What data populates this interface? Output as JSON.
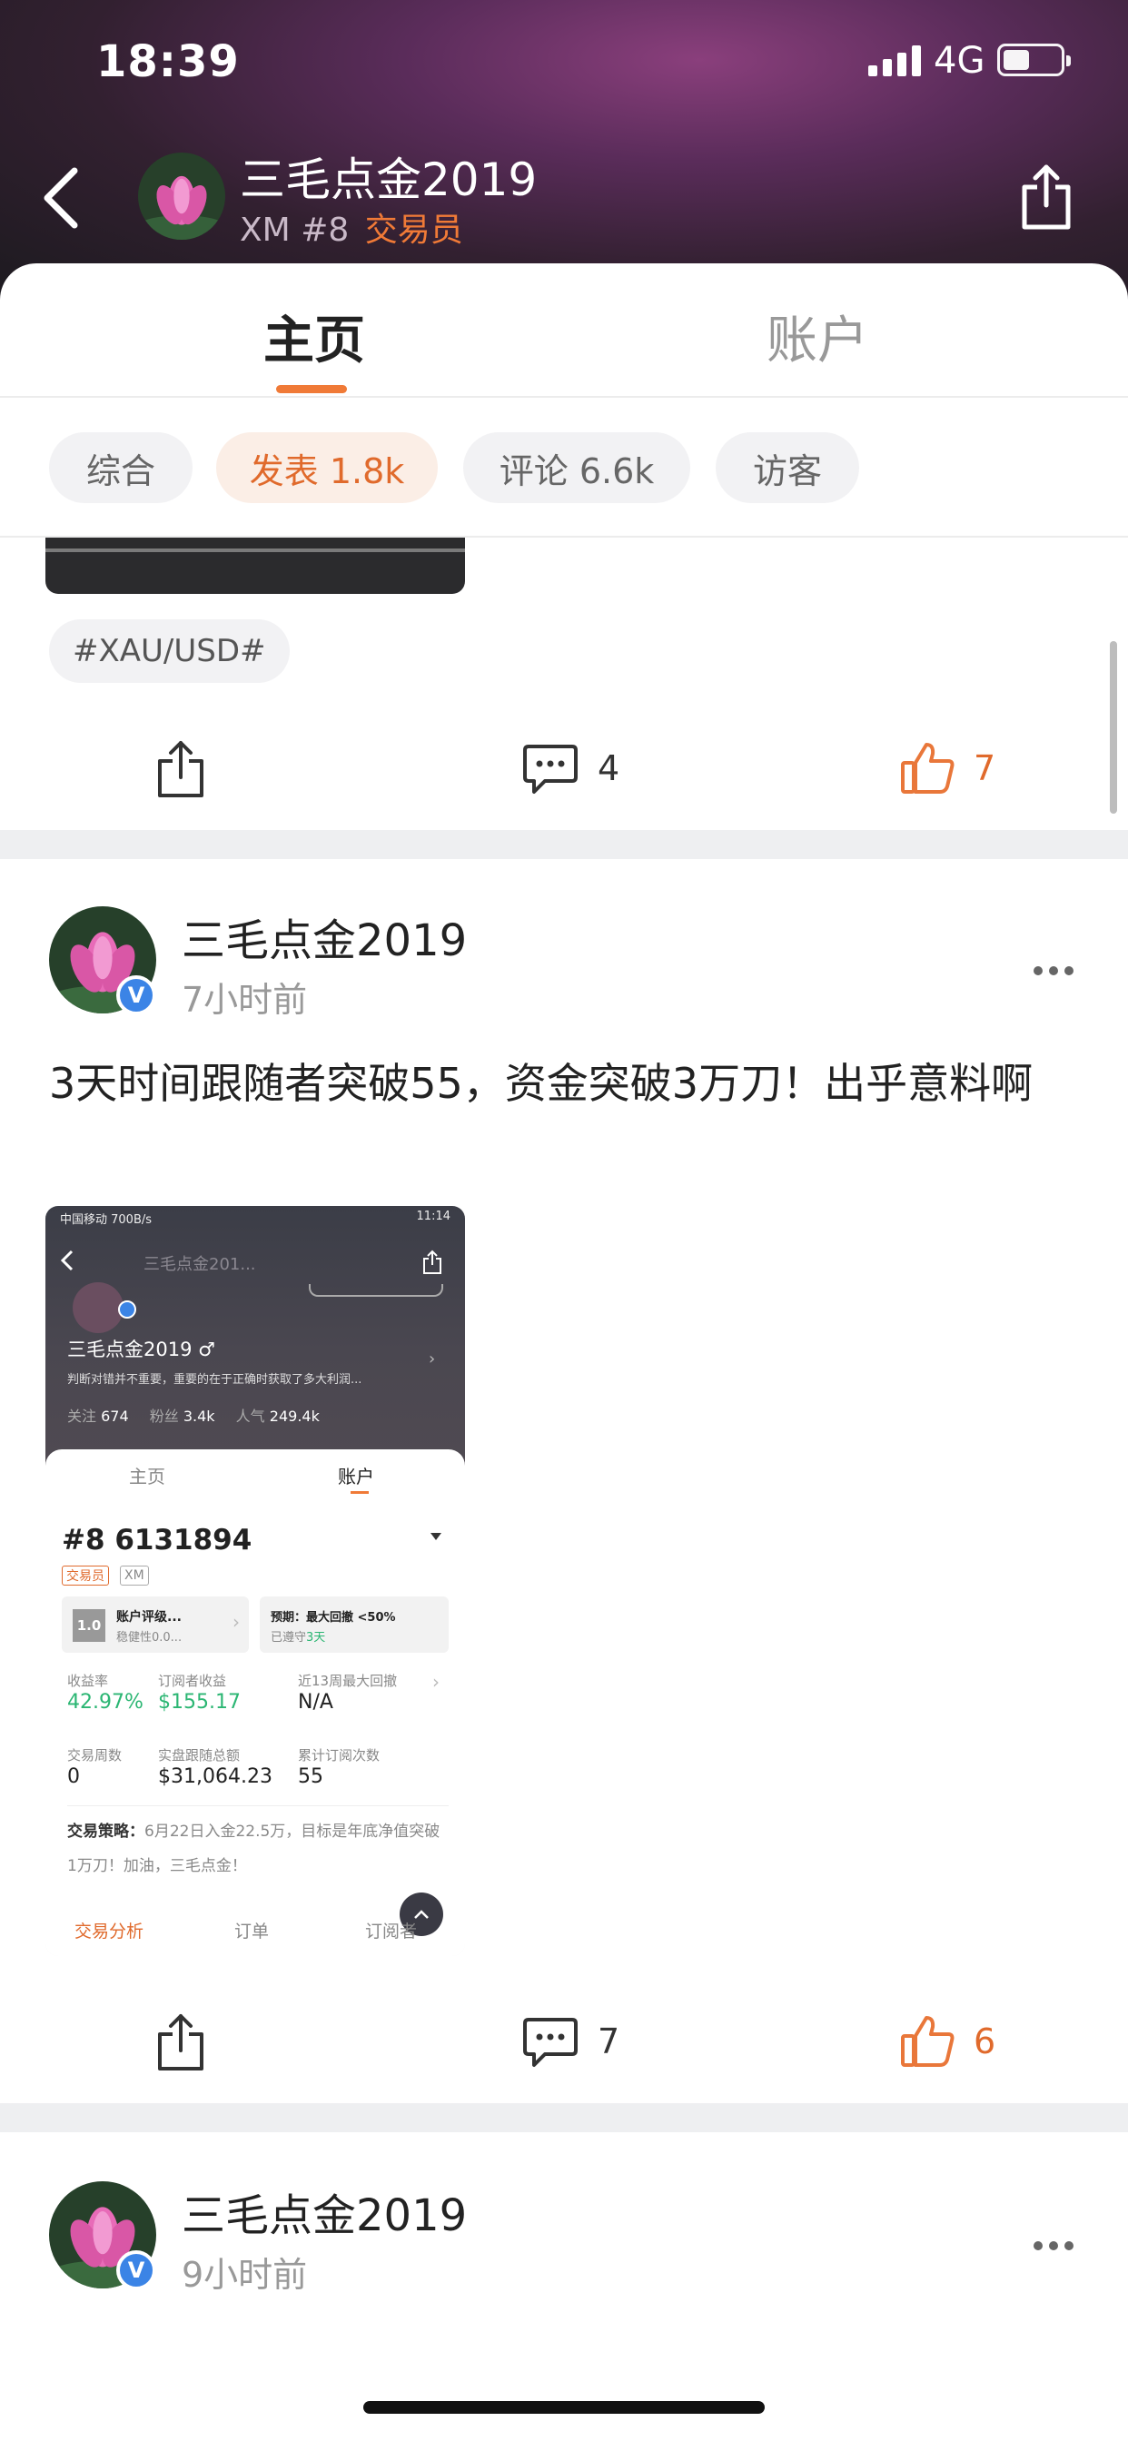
{
  "status_bar": {
    "time": "18:39",
    "network": "4G"
  },
  "header": {
    "name": "三毛点金2019",
    "broker": "XM",
    "rank": "#8",
    "role": "交易员"
  },
  "tabs": [
    {
      "label": "主页",
      "active": true
    },
    {
      "label": "账户",
      "active": false
    }
  ],
  "filters": [
    {
      "label": "综合",
      "active": false
    },
    {
      "label": "发表 1.8k",
      "active": true
    },
    {
      "label": "评论 6.6k",
      "active": false
    },
    {
      "label": "访客",
      "active": false
    }
  ],
  "post1": {
    "tag": "#XAU/USD#",
    "comments": "4",
    "likes": "7"
  },
  "post2": {
    "author": "三毛点金2019",
    "time": "7小时前",
    "text": "3天时间跟随者突破55，资金突破3万刀！出乎意料啊",
    "comments": "7",
    "likes": "6",
    "screenshot": {
      "status_left": "中国移动 700B/s",
      "status_right": "11:14",
      "nav_name": "三毛点金201...",
      "name": "三毛点金2019 ♂",
      "desc": "判断对错并不重要，重要的在于正确时获取了多大利润...",
      "follow_label": "关注",
      "follow": "674",
      "fans_label": "粉丝",
      "fans": "3.4k",
      "popularity_label": "人气",
      "popularity": "249.4k",
      "tab_home": "主页",
      "tab_account": "账户",
      "account_no": "#8 6131894",
      "badge_role": "交易员",
      "badge_broker": "XM",
      "rating_score": "1.0",
      "rating_title": "账户评级...",
      "rating_sub": "稳健性0.0...",
      "expect_title": "预期：最大回撤 <50%",
      "expect_sub_prefix": "已遵守",
      "expect_sub_days": "3天",
      "stats": [
        {
          "label": "收益率",
          "value": "42.97%",
          "green": true
        },
        {
          "label": "订阅者收益",
          "value": "$155.17",
          "green": true
        },
        {
          "label": "近13周最大回撤",
          "value": "N/A",
          "green": false
        },
        {
          "label": "交易周数",
          "value": "0",
          "green": false
        },
        {
          "label": "实盘跟随总额",
          "value": "$31,064.23",
          "green": false
        },
        {
          "label": "累计订阅次数",
          "value": "55",
          "green": false
        }
      ],
      "strategy_label": "交易策略：",
      "strategy_text": "6月22日入金22.5万，目标是年底净值突破1万刀！加油，三毛点金！",
      "bottom_tabs": [
        "交易分析",
        "订单",
        "订阅者"
      ]
    }
  },
  "post3": {
    "author": "三毛点金2019",
    "time": "9小时前"
  },
  "colors": {
    "accent": "#f07a37",
    "verify": "#3b84e6",
    "green": "#2bb673"
  }
}
